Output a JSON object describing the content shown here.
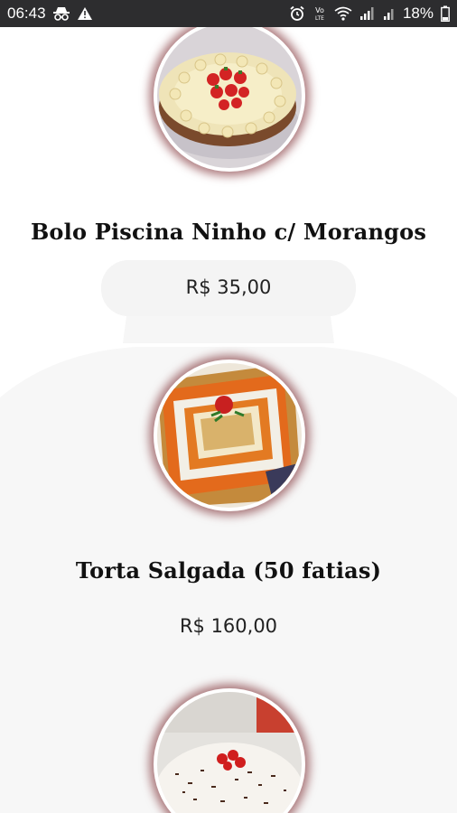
{
  "status_bar": {
    "time": "06:43",
    "network_label": "Vo)\nLTE",
    "battery": "18%"
  },
  "products": [
    {
      "name": "Bolo Piscina Ninho c/ Morangos",
      "price": "R$ 35,00",
      "image_icon": "strawberry-cake-image"
    },
    {
      "name": "Torta Salgada (50 fatias)",
      "price": "R$ 160,00",
      "image_icon": "savory-pie-image"
    },
    {
      "name": "",
      "price": "",
      "image_icon": "chocolate-cake-image"
    }
  ]
}
